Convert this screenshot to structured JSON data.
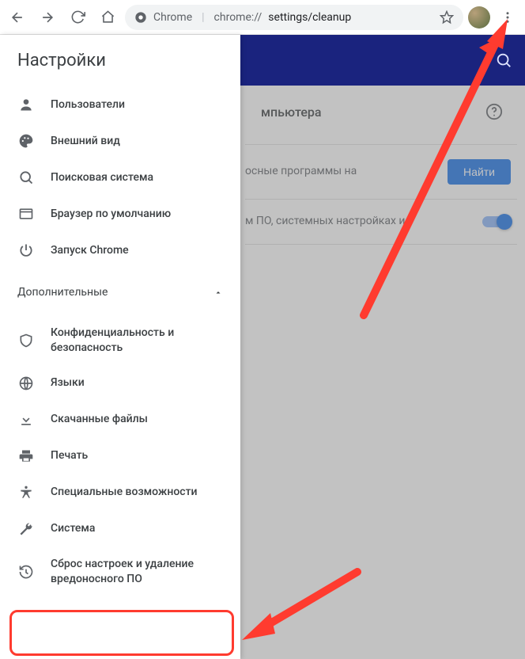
{
  "browser": {
    "url_host_label": "Chrome",
    "url_dim": "chrome://",
    "url_path": "settings/cleanup"
  },
  "appbar": {
    "title": "Настройки"
  },
  "page": {
    "section_title_suffix": "мпьютера",
    "find_row_text": "осные программы на",
    "find_button": "Найти",
    "report_row_text": "м ПО, системных настройках и"
  },
  "sidebar": {
    "title": "Настройки",
    "items_basic": [
      {
        "icon": "person",
        "label": "Пользователи"
      },
      {
        "icon": "palette",
        "label": "Внешний вид"
      },
      {
        "icon": "search",
        "label": "Поисковая система"
      },
      {
        "icon": "browser",
        "label": "Браузер по умолчанию"
      },
      {
        "icon": "power",
        "label": "Запуск Chrome"
      }
    ],
    "section_label": "Дополнительные",
    "items_advanced": [
      {
        "icon": "shield",
        "label": "Конфиденциальность и безопасность"
      },
      {
        "icon": "globe",
        "label": "Языки"
      },
      {
        "icon": "download",
        "label": "Скачанные файлы"
      },
      {
        "icon": "print",
        "label": "Печать"
      },
      {
        "icon": "accessibility",
        "label": "Специальные возможности"
      },
      {
        "icon": "wrench",
        "label": "Система"
      },
      {
        "icon": "restore",
        "label": "Сброс настроек и удаление вредоносного ПО"
      }
    ]
  }
}
